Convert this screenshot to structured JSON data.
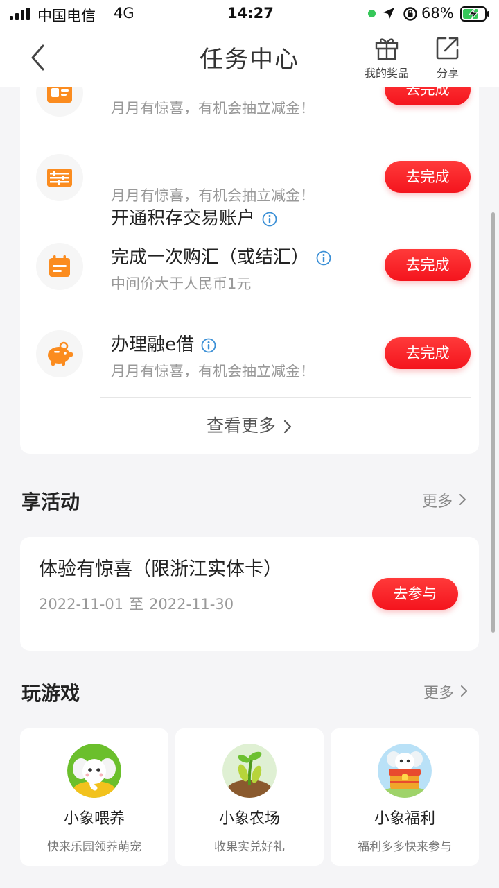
{
  "status_bar": {
    "carrier": "中国电信",
    "network": "4G",
    "time": "14:27",
    "battery_percent": "68%"
  },
  "nav": {
    "title": "任务中心",
    "prizes_label": "我的奖品",
    "share_label": "分享"
  },
  "tasks": [
    {
      "title": "",
      "desc": "月月有惊喜，有机会抽立减金！",
      "button": "去完成",
      "icon": "card-icon"
    },
    {
      "title": "开通积存交易账户",
      "desc": "月月有惊喜，有机会抽立减金！",
      "button": "去完成",
      "icon": "abacus-icon"
    },
    {
      "title": "完成一次购汇（或结汇）",
      "desc": "中间价大于人民币1元",
      "button": "去完成",
      "icon": "calendar-icon"
    },
    {
      "title": "办理融e借",
      "desc": "月月有惊喜，有机会抽立减金！",
      "button": "去完成",
      "icon": "piggy-bank-icon"
    }
  ],
  "tasks_more": "查看更多",
  "activities": {
    "title": "享活动",
    "more": "更多",
    "item": {
      "title": "体验有惊喜（限浙江实体卡）",
      "start": "2022-11-01",
      "separator": "至",
      "end": "2022-11-30",
      "button": "去参与"
    }
  },
  "games": {
    "title": "玩游戏",
    "more": "更多",
    "items": [
      {
        "name": "小象喂养",
        "desc": "快来乐园领养萌宠"
      },
      {
        "name": "小象农场",
        "desc": "收果实兑好礼"
      },
      {
        "name": "小象福利",
        "desc": "福利多多快来参与"
      }
    ]
  },
  "colors": {
    "accent_red": "#f4141d",
    "icon_orange": "#fb8c1f",
    "info_blue": "#3a8fd6"
  }
}
